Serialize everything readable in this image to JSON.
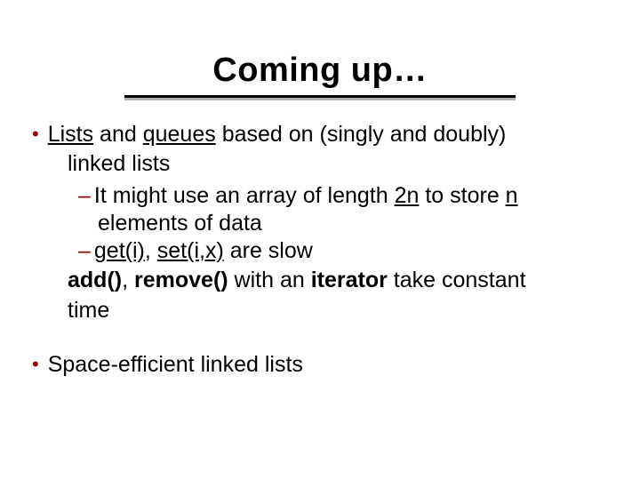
{
  "title": "Coming up…",
  "b1": {
    "pre": "Lists",
    "mid": " and ",
    "q": "queues",
    "post": " based on (singly and doubly)",
    "cont": "linked lists"
  },
  "sub1": {
    "pre": "It might use an array of length ",
    "twon": "2n",
    "mid": " to store ",
    "n": "n",
    "cont": "elements of data"
  },
  "sub2": {
    "g": "get(i)",
    "comma": ", ",
    "s": "set(i,x)",
    "post": " are slow"
  },
  "line3": {
    "a": "add()",
    "c1": ", ",
    "r": "remove()",
    "mid": " with an ",
    "it": "iterator",
    "post": " take constant",
    "cont": "time"
  },
  "b2": "Space-efficient linked lists"
}
